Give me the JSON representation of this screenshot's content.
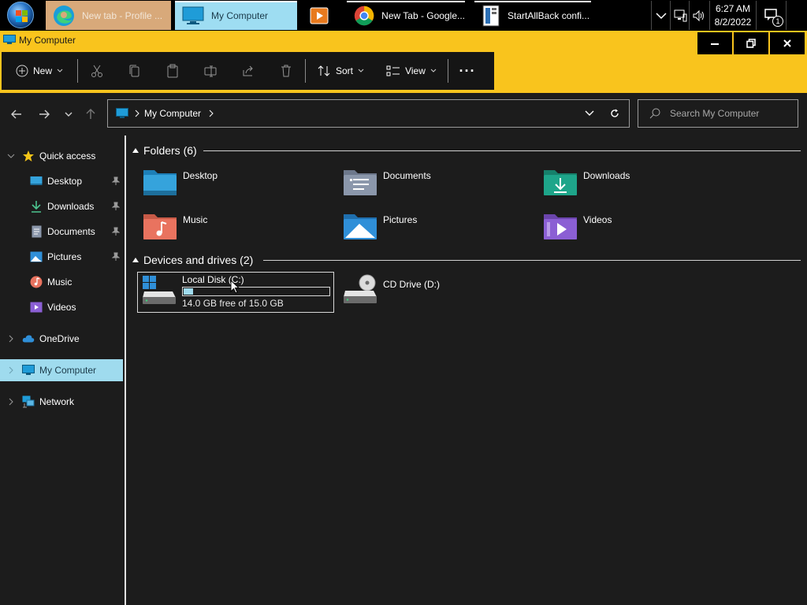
{
  "taskbar": {
    "items": [
      {
        "label": "New tab - Profile ...",
        "icon": "edge-icon"
      },
      {
        "label": "My Computer",
        "icon": "computer-icon"
      },
      {
        "label": "",
        "icon": "vlc-icon"
      },
      {
        "label": "New Tab - Google...",
        "icon": "chrome-icon"
      },
      {
        "label": "StartAllBack confi...",
        "icon": "startallback-icon"
      }
    ],
    "clock": {
      "time": "6:27 AM",
      "date": "8/2/2022"
    },
    "notification_count": "1"
  },
  "window": {
    "title": "My Computer",
    "accent_color": "#f9c41d"
  },
  "toolbar": {
    "new_label": "New",
    "sort_label": "Sort",
    "view_label": "View",
    "more_label": "···"
  },
  "address": {
    "breadcrumb": "My Computer",
    "search_placeholder": "Search My Computer"
  },
  "sidebar": {
    "quick_access": "Quick access",
    "items": [
      {
        "label": "Desktop"
      },
      {
        "label": "Downloads"
      },
      {
        "label": "Documents"
      },
      {
        "label": "Pictures"
      },
      {
        "label": "Music"
      },
      {
        "label": "Videos"
      }
    ],
    "onedrive": "OneDrive",
    "my_computer": "My Computer",
    "network": "Network"
  },
  "folders": {
    "header": "Folders (6)",
    "items": [
      {
        "label": "Desktop",
        "color": "#35a3dc"
      },
      {
        "label": "Documents",
        "color": "#8b97ab"
      },
      {
        "label": "Downloads",
        "color": "#1ea58a"
      },
      {
        "label": "Music",
        "color": "#e9735f"
      },
      {
        "label": "Pictures",
        "color": "#2f8fd8"
      },
      {
        "label": "Videos",
        "color": "#8b5fd4"
      }
    ]
  },
  "drives": {
    "header": "Devices and drives (2)",
    "local_disk": {
      "label": "Local Disk (C:)",
      "free_text": "14.0 GB free of 15.0 GB",
      "used_fraction": 0.067
    },
    "cd_drive": {
      "label": "CD Drive (D:)"
    }
  }
}
